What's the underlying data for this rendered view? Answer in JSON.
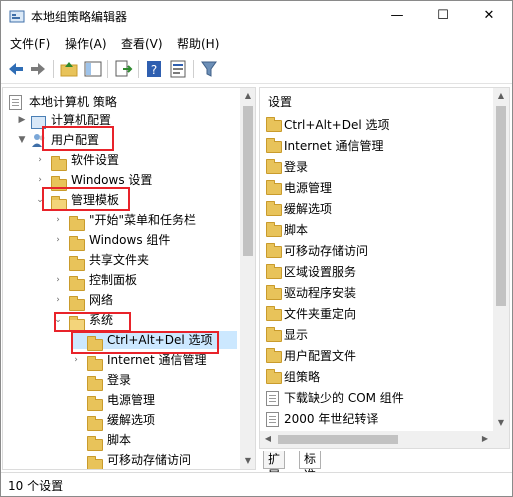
{
  "window": {
    "title": "本地组策略编辑器",
    "minimize": "—",
    "maximize": "☐",
    "close": "✕"
  },
  "menu": {
    "items": [
      "文件(F)",
      "操作(A)",
      "查看(V)",
      "帮助(H)"
    ]
  },
  "toolbar": {
    "icons": [
      "back-arrow-icon",
      "forward-arrow-icon",
      "up-folder-icon",
      "show-tree-icon",
      "export-list-icon",
      "help-icon",
      "properties-icon",
      "filter-icon"
    ]
  },
  "tree": {
    "root": "本地计算机 策略",
    "computer_config": "计算机配置",
    "user_config": "用户配置",
    "software_settings": "软件设置",
    "windows_settings": "Windows 设置",
    "admin_templates": "管理模板",
    "start_menu": "\"开始\"菜单和任务栏",
    "windows_components": "Windows 组件",
    "shared_folders": "共享文件夹",
    "control_panel": "控制面板",
    "network": "网络",
    "system": "系统",
    "ctrl_alt_del": "Ctrl+Alt+Del 选项",
    "internet_comm": "Internet 通信管理",
    "logon": "登录",
    "power_mgmt": "电源管理",
    "mitigation": "缓解选项",
    "scripts": "脚本",
    "removable_storage": "可移动存储访问"
  },
  "right_pane": {
    "header": "设置",
    "items": [
      "Ctrl+Alt+Del 选项",
      "Internet 通信管理",
      "登录",
      "电源管理",
      "缓解选项",
      "脚本",
      "可移动存储访问",
      "区域设置服务",
      "驱动程序安装",
      "文件夹重定向",
      "显示",
      "用户配置文件",
      "组策略",
      "下载缺少的 COM 组件",
      "2000 年世纪转译"
    ]
  },
  "tabs": [
    "扩展",
    "标准"
  ],
  "status": "10 个设置",
  "colors": {
    "highlight": "#e8232a",
    "folder": "#e8c35a"
  }
}
